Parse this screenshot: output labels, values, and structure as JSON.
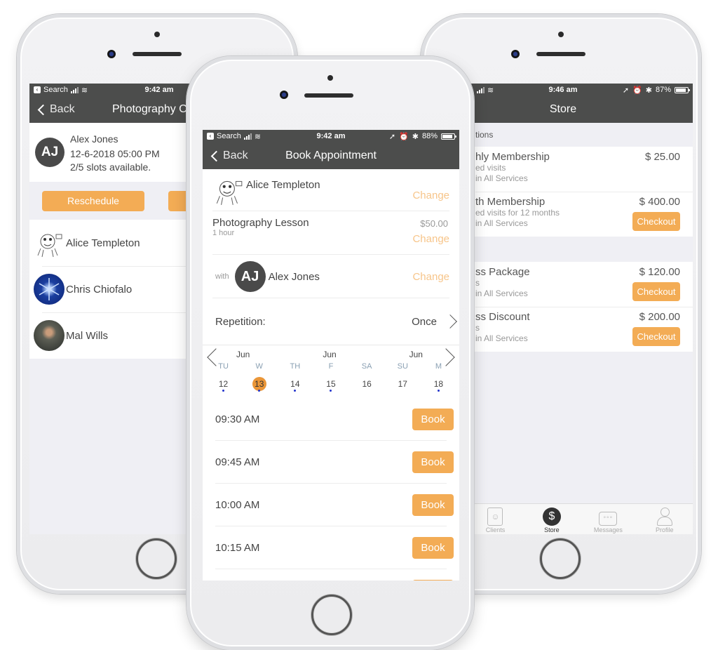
{
  "colors": {
    "accent": "#f3ac55",
    "navbar": "#4c4d4c",
    "selected_day": "#ea9638",
    "event_dot": "#2233cc"
  },
  "left_phone": {
    "status": {
      "back_app": "Search",
      "time": "9:42 am"
    },
    "nav": {
      "back_label": "Back",
      "title": "Photography Cl"
    },
    "header": {
      "avatar_initials": "AJ",
      "name": "Alex Jones",
      "datetime": "12-6-2018 05:00 PM",
      "slots": "2/5 slots available."
    },
    "actions": {
      "reschedule_label": "Reschedule"
    },
    "clients": [
      {
        "name": "Alice Templeton",
        "avatar": "sketch-avatar"
      },
      {
        "name": "Chris Chiofalo",
        "avatar": "snowflake-avatar"
      },
      {
        "name": "Mal Wills",
        "avatar": "photo-avatar"
      }
    ]
  },
  "center_phone": {
    "status": {
      "back_app": "Search",
      "time": "9:42 am",
      "battery": "88%",
      "battery_level": 0.88
    },
    "nav": {
      "back_label": "Back",
      "title": "Book Appointment"
    },
    "client": {
      "name": "Alice Templeton",
      "change_label": "Change"
    },
    "service": {
      "name": "Photography Lesson",
      "duration": "1 hour",
      "price": "$50.00",
      "change_label": "Change"
    },
    "staff": {
      "with_label": "with",
      "avatar_initials": "AJ",
      "name": "Alex Jones",
      "change_label": "Change"
    },
    "repetition": {
      "label": "Repetition:",
      "value": "Once"
    },
    "calendar": {
      "months": [
        "Jun",
        "Jun",
        "Jun"
      ],
      "days": [
        {
          "name": "TU",
          "num": "12",
          "has_events": true,
          "selected": false
        },
        {
          "name": "W",
          "num": "13",
          "has_events": true,
          "selected": true
        },
        {
          "name": "TH",
          "num": "14",
          "has_events": true,
          "selected": false
        },
        {
          "name": "F",
          "num": "15",
          "has_events": true,
          "selected": false
        },
        {
          "name": "SA",
          "num": "16",
          "has_events": false,
          "selected": false
        },
        {
          "name": "SU",
          "num": "17",
          "has_events": false,
          "selected": false
        },
        {
          "name": "M",
          "num": "18",
          "has_events": true,
          "selected": false
        }
      ]
    },
    "slots": [
      {
        "time": "09:30 AM",
        "book_label": "Book"
      },
      {
        "time": "09:45 AM",
        "book_label": "Book"
      },
      {
        "time": "10:00 AM",
        "book_label": "Book"
      },
      {
        "time": "10:15 AM",
        "book_label": "Book"
      },
      {
        "time": "",
        "book_label": ""
      }
    ]
  },
  "right_phone": {
    "status": {
      "time": "9:46 am",
      "battery": "87%",
      "battery_level": 0.87
    },
    "nav": {
      "title": "Store"
    },
    "section_label": "tions",
    "items_group1": [
      {
        "title": "hly Membership",
        "sub1": "ed visits",
        "sub2": "in All Services",
        "price": "$ 25.00",
        "checkout_label": ""
      },
      {
        "title": "th Membership",
        "sub1": "ed visits for 12 months",
        "sub2": "in All Services",
        "price": "$ 400.00",
        "checkout_label": "Checkout"
      }
    ],
    "items_group2": [
      {
        "title": "ss Package",
        "sub1": "s",
        "sub2": "in All Services",
        "price": "$ 120.00",
        "checkout_label": "Checkout"
      },
      {
        "title": "ss Discount",
        "sub1": "s",
        "sub2": "in All Services",
        "price": "$ 200.00",
        "checkout_label": "Checkout"
      }
    ],
    "tabs": [
      {
        "label": "Clients",
        "icon": "clients-icon",
        "active": false
      },
      {
        "label": "Store",
        "icon": "dollar-icon",
        "active": true
      },
      {
        "label": "Messages",
        "icon": "messages-icon",
        "active": false
      },
      {
        "label": "Profile",
        "icon": "profile-icon",
        "active": false
      }
    ]
  }
}
